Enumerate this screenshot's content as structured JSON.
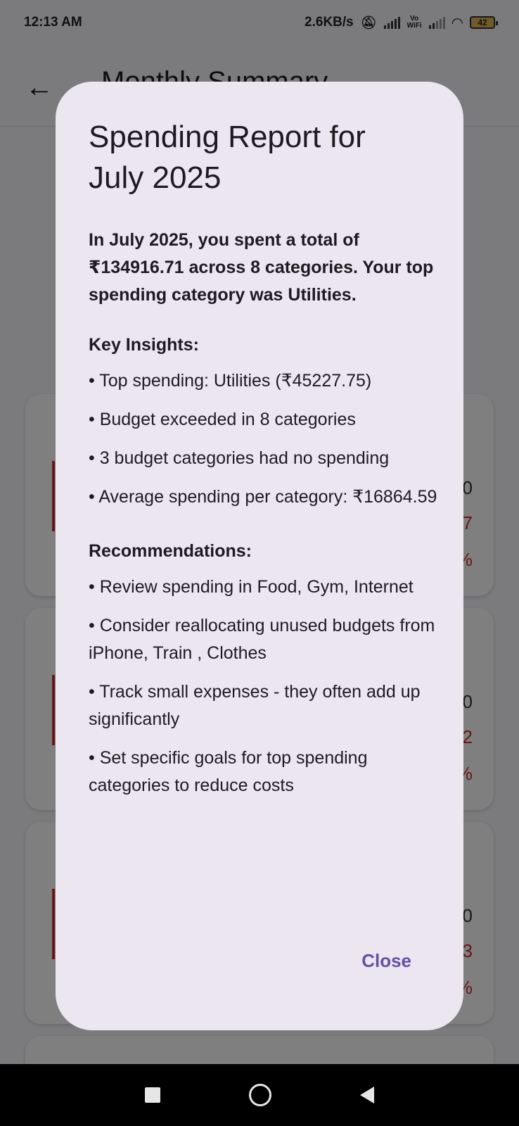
{
  "status_bar": {
    "time": "12:13 AM",
    "net_speed": "2.6KB/s",
    "wifi_label": "Vo\nWiFi",
    "battery": "42"
  },
  "app_bar": {
    "title": "Monthly Summary"
  },
  "background_cards": [
    {
      "top_value": "0",
      "mid_value": "7",
      "pct": "%"
    },
    {
      "top_value": "0",
      "mid_value": "2",
      "pct": "%"
    },
    {
      "top_value": "0",
      "mid_value": "3",
      "pct": "%"
    }
  ],
  "dialog": {
    "title": "Spending Report for July 2025",
    "summary": "In July 2025, you spent a total of ₹134916.71 across 8 categories. Your top spending category was Utilities.",
    "insights_heading": "Key Insights:",
    "insights": [
      "• Top spending: Utilities (₹45227.75)",
      "• Budget exceeded in 8 categories",
      "• 3 budget categories had no spending",
      "• Average spending per category: ₹16864.59"
    ],
    "recommendations_heading": "Recommendations:",
    "recommendations": [
      "• Review spending in Food, Gym, Internet",
      "• Consider reallocating unused budgets from iPhone, Train , Clothes",
      "• Track small expenses - they often add up significantly",
      "• Set specific goals for top spending categories to reduce costs"
    ],
    "close_label": "Close"
  },
  "colors": {
    "dialog_bg": "#ece6f0",
    "primary": "#6750a4",
    "accent_red": "#d32f2f"
  }
}
